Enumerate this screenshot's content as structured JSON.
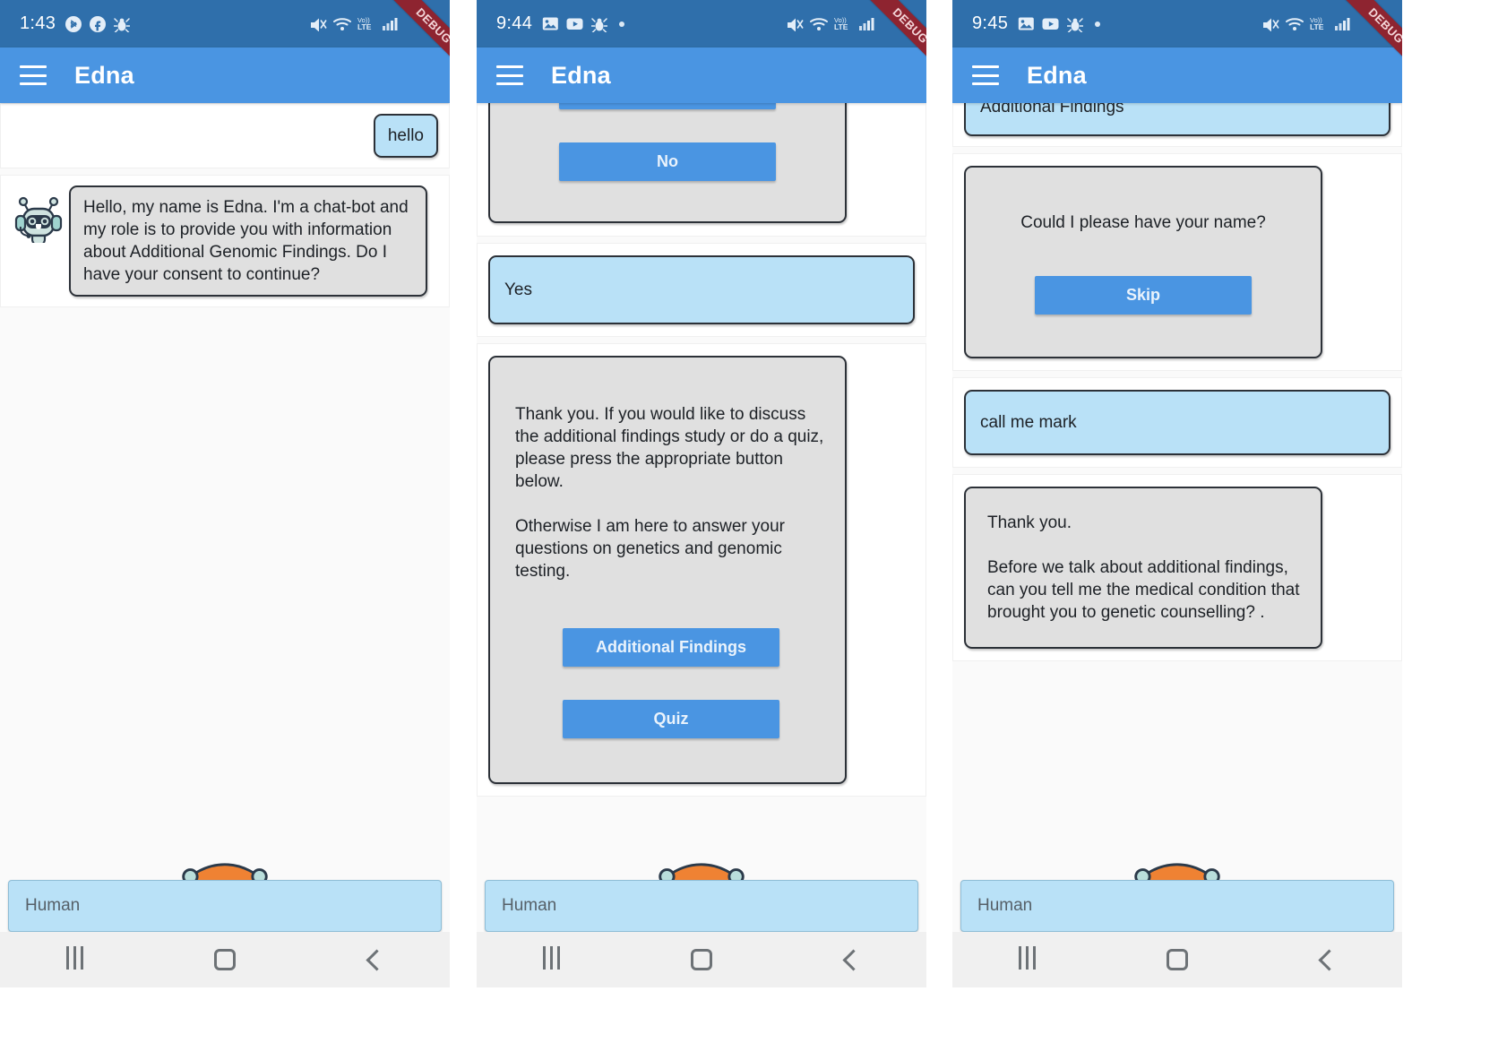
{
  "app": {
    "title": "Edna",
    "debug_ribbon_label": "DEBUG",
    "accent_blue": "#4a95e2",
    "statusbar_blue": "#2f6fab",
    "user_bubble_color": "#b9e1f7",
    "bot_bubble_color": "#e0e0e0",
    "ribbon_color": "#8e2430"
  },
  "panels": [
    {
      "status": {
        "time": "1:43",
        "left_icons": [
          "bluetooth-icon",
          "facebook-icon",
          "bug-icon"
        ],
        "right_icons": [
          "mute-icon",
          "wifi-icon",
          "volte-icon",
          "signal-icon"
        ]
      },
      "messages": [
        {
          "type": "user",
          "text": "hello",
          "inline": true
        },
        {
          "type": "bot",
          "avatar": true,
          "text": "Hello, my name is Edna. I'm a chat-bot and my role is to provide you with information about Additional Genomic Findings. Do I have your consent to continue?"
        }
      ],
      "input_placeholder": "Human"
    },
    {
      "status": {
        "time": "9:44",
        "left_icons": [
          "image-icon",
          "youtube-icon",
          "bug-icon",
          "dot-icon"
        ],
        "right_icons": [
          "mute-icon",
          "wifi-icon",
          "volte-icon",
          "signal-icon"
        ]
      },
      "messages": [
        {
          "type": "bot",
          "clipped_top": true,
          "text": "",
          "buttons": [
            "No"
          ]
        },
        {
          "type": "user",
          "text": "Yes"
        },
        {
          "type": "bot",
          "text": "Thank you. If you would like to discuss the additional findings study or do a quiz, please press the appropriate button below.\n\nOtherwise I am here to answer your questions on genetics and genomic testing.",
          "buttons": [
            "Additional Findings",
            "Quiz"
          ]
        }
      ],
      "input_placeholder": "Human"
    },
    {
      "status": {
        "time": "9:45",
        "left_icons": [
          "image-icon",
          "youtube-icon",
          "bug-icon",
          "dot-icon"
        ],
        "right_icons": [
          "mute-icon",
          "wifi-icon",
          "volte-icon",
          "signal-icon"
        ]
      },
      "messages": [
        {
          "type": "user",
          "clipped_top": true,
          "text": "Additional Findings"
        },
        {
          "type": "bot",
          "text": "Could I please have your name?",
          "buttons": [
            "Skip"
          ]
        },
        {
          "type": "user",
          "text": "call me mark"
        },
        {
          "type": "bot",
          "text": "Thank you.\n\nBefore we talk about additional findings, can you tell me the medical condition that brought you to genetic counselling? ."
        }
      ],
      "input_placeholder": "Human"
    }
  ],
  "navbar": {
    "recents_label": "recents-button",
    "home_label": "home-button",
    "back_label": "back-button"
  }
}
